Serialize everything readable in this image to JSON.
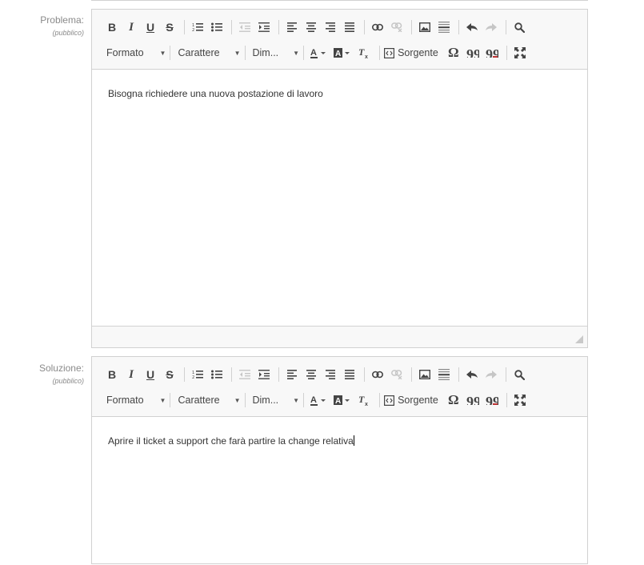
{
  "editors": [
    {
      "label": "Problema:",
      "sublabel": "(pubblico)",
      "content": "Bisogna richiedere una nuova postazione di lavoro"
    },
    {
      "label": "Soluzione:",
      "sublabel": "(pubblico)",
      "content": "Aprire il ticket a support che farà partire la change relativa"
    }
  ],
  "toolbar": {
    "format_label": "Formato",
    "font_label": "Carattere",
    "size_label": "Dim...",
    "source_label": "Sorgente",
    "bold": "B",
    "italic": "I",
    "underline": "U",
    "strike": "S",
    "omega": "Ω"
  },
  "colors": {
    "toolbar_bg": "#f8f8f8",
    "border": "#d1d1d1",
    "label": "#8a8a8a"
  }
}
